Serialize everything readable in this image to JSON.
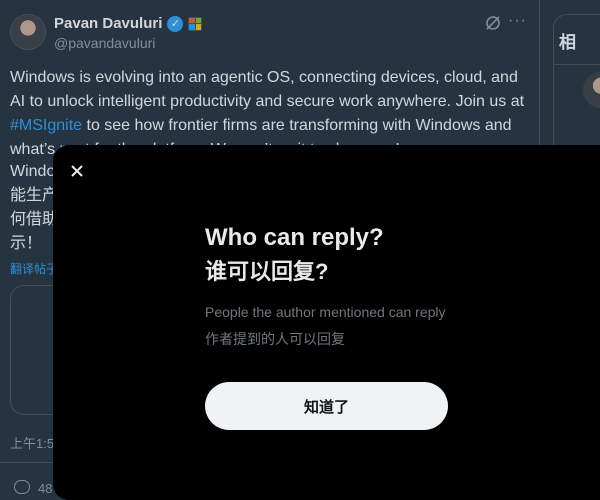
{
  "post": {
    "author_name": "Pavan Davuluri",
    "handle": "@pavandavuluri",
    "text_before": "Windows is evolving into an agentic OS, connecting devices, cloud, and AI to unlock intelligent productivity and secure work anywhere. Join us at ",
    "hashtag": "#MSIgnite",
    "text_after": " to see how frontier firms are transforming with Windows and what’s next for the platform. We can’t wait to show you!",
    "text_zh": "Windows 正在演进为一个代理式操作系统，连接设备、云和 AI，释放智能生产力并保障随处安全工作。加入我们，在 #MSIgnite 了解前沿企业如何借助 Windows 实现转型，以及平台的未来。我们迫不及待地想向你展示！",
    "translate_label": "翻译帖子",
    "timestamp": "上午1:5",
    "reply_count": "48",
    "verified_icon": "verified-badge-icon",
    "affiliation_icon": "microsoft-logo-icon",
    "more_icon": "more-horizontal-icon",
    "grok_icon": "grok-icon"
  },
  "sidebar": {
    "heading": "相"
  },
  "modal": {
    "close_icon": "close-icon",
    "title": "Who can reply?",
    "title_zh": "谁可以回复?",
    "description": "People the author mentioned can reply",
    "description_zh": "作者提到的人可以回复",
    "button_label": "知道了"
  },
  "colors": {
    "page_bg": "#15202b",
    "modal_bg": "#000000",
    "accent": "#1d9bf0",
    "muted": "#71767b",
    "button_bg": "#eff3f4"
  }
}
